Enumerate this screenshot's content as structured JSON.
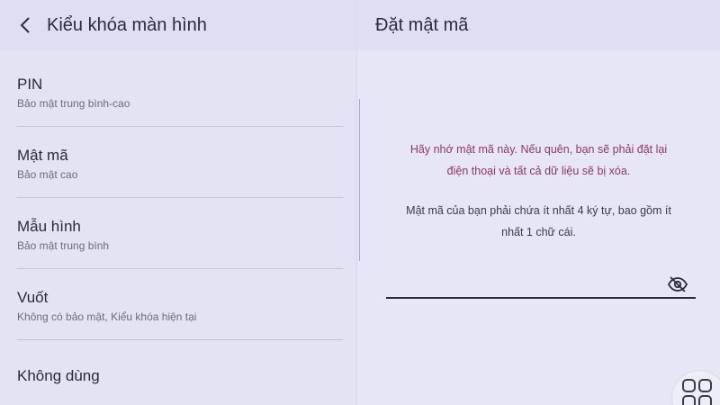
{
  "left_panel": {
    "title": "Kiểu khóa màn hình",
    "back_icon": "chevron-left-icon",
    "items": [
      {
        "label": "PIN",
        "sublabel": "Bảo mật trung bình-cao"
      },
      {
        "label": "Mật mã",
        "sublabel": "Bảo mật cao"
      },
      {
        "label": "Mẫu hình",
        "sublabel": "Bảo mật trung bình"
      },
      {
        "label": "Vuốt",
        "sublabel": "Không có bảo mật, Kiểu khóa hiện tại"
      },
      {
        "label": "Không dùng"
      }
    ]
  },
  "right_panel": {
    "title": "Đặt mật mã",
    "warning_line1": "Hãy nhớ mật mã này. Nếu quên, bạn sẽ phải đặt lại",
    "warning_line2": "điện thoại và tất cả dữ liệu sẽ bị xóa.",
    "requirement_line1": "Mật mã của bạn phải chứa ít nhất 4 ký tự, bao gồm ít",
    "requirement_line2": "nhất 1 chữ cái.",
    "password_value": "",
    "visibility_icon": "eye-off-icon",
    "floating_icon": "grid-icon"
  },
  "colors": {
    "background": "#dcdcf0",
    "warning_text": "#8a3a62",
    "underline": "#2b2b3b"
  }
}
